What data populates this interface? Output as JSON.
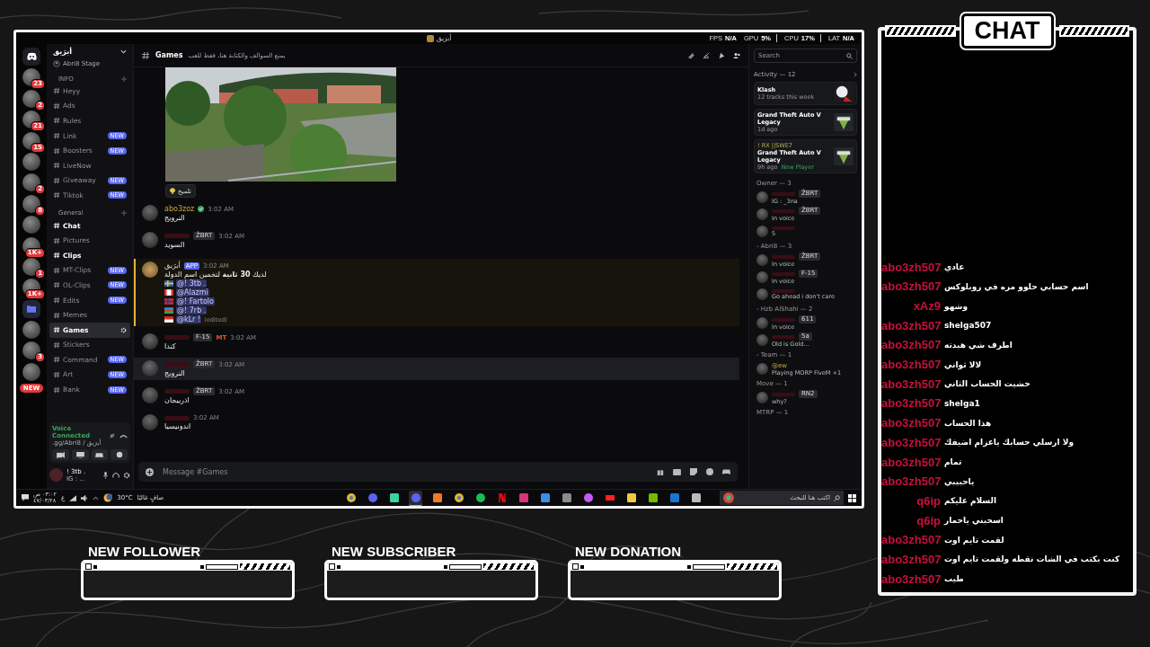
{
  "discord": {
    "title": "أبرَيق",
    "stats": [
      {
        "label": "FPS",
        "value": "N/A"
      },
      {
        "label": "GPU",
        "value": "5%"
      },
      {
        "label": "CPU",
        "value": "17%"
      },
      {
        "label": "LAT",
        "value": "N/A"
      }
    ],
    "servers": [
      {
        "kind": "home"
      },
      {
        "kind": "server",
        "badge": "23"
      },
      {
        "kind": "server",
        "badge": "2"
      },
      {
        "kind": "server",
        "badge": "21"
      },
      {
        "kind": "server",
        "badge": "15"
      },
      {
        "kind": "server"
      },
      {
        "kind": "server",
        "badge": "2"
      },
      {
        "kind": "server",
        "badge": "8"
      },
      {
        "kind": "server"
      },
      {
        "kind": "server",
        "badge": "1K+"
      },
      {
        "kind": "server",
        "badge": "1"
      },
      {
        "kind": "server",
        "badge": "1K+"
      },
      {
        "kind": "folder"
      },
      {
        "kind": "server"
      },
      {
        "kind": "server",
        "badge": "3"
      },
      {
        "kind": "server"
      },
      {
        "kind": "new",
        "label": "NEW"
      }
    ],
    "server_name": "أبرَيق",
    "stage": "Abri8 Stage",
    "categories": [
      {
        "name": "INFO",
        "channels": [
          {
            "name": "Heyy",
            "unread": false,
            "selected": false
          },
          {
            "name": "Ads",
            "unread": false,
            "selected": false
          },
          {
            "name": "Rules",
            "unread": false,
            "selected": false
          },
          {
            "name": "Link",
            "badge": "NEW",
            "unread": false,
            "selected": false
          },
          {
            "name": "Boosters",
            "badge": "NEW",
            "unread": false,
            "selected": false
          },
          {
            "name": "LiveNow",
            "unread": false,
            "selected": false
          },
          {
            "name": "Giveaway",
            "badge": "NEW",
            "unread": false,
            "selected": false
          },
          {
            "name": "Tiktok",
            "badge": "NEW",
            "unread": false,
            "selected": false
          }
        ]
      },
      {
        "name": "General",
        "channels": [
          {
            "name": "Chat",
            "unread": true,
            "selected": false
          },
          {
            "name": "Pictures",
            "unread": false,
            "selected": false
          },
          {
            "name": "Clips",
            "unread": true,
            "selected": false
          },
          {
            "name": "MT-Clips",
            "badge": "NEW",
            "unread": false,
            "selected": false
          },
          {
            "name": "OL-Clips",
            "badge": "NEW",
            "unread": false,
            "selected": false
          },
          {
            "name": "Edits",
            "badge": "NEW",
            "unread": false,
            "selected": false
          },
          {
            "name": "Memes",
            "unread": false,
            "selected": false
          },
          {
            "name": "Games",
            "unread": false,
            "selected": true
          },
          {
            "name": "Stickers",
            "unread": false,
            "selected": false
          },
          {
            "name": "Command",
            "badge": "NEW",
            "unread": false,
            "selected": false
          },
          {
            "name": "Art",
            "badge": "NEW",
            "unread": false,
            "selected": false
          },
          {
            "name": "Bank",
            "badge": "NEW",
            "unread": false,
            "selected": false
          }
        ]
      }
    ],
    "voice": {
      "status": "Voice Connected",
      "location": ".gg/Abri8 / أبرَيق"
    },
    "user": {
      "name": "! 3tb .",
      "status": "IG : ..."
    },
    "channel": {
      "name": "Games",
      "topic": "يمنع السوالف والكتابة هنا، فقط للعب"
    },
    "hint_button": "تلميح",
    "messages": [
      {
        "author": "abo3zoz",
        "verified": true,
        "time": "3:02 AM",
        "text": "النرويج"
      },
      {
        "author_redacted": true,
        "tag": "ŽBRT",
        "time": "3:02 AM",
        "text": "السويد"
      },
      {
        "author": "أبرَيق",
        "app": "APP",
        "time": "3:02 AM",
        "highlighted": true,
        "text": "لديك **30 ثانية** لتخمين اسم الدولة",
        "mentions": [
          {
            "kind": "se",
            "name": "@! 3tb ."
          },
          {
            "kind": "ca",
            "name": "@Alazmi"
          },
          {
            "kind": "no",
            "name": "@! Fartolo"
          },
          {
            "kind": "az",
            "name": "@! 7rb ."
          },
          {
            "kind": "id",
            "name": "@kLr !",
            "note": "(edited)"
          }
        ]
      },
      {
        "author_redacted": true,
        "tag": "F-15",
        "tag2": "MT",
        "time": "3:02 AM",
        "text": "كندا"
      },
      {
        "author_redacted": true,
        "tag": "ŽBRT",
        "time": "3:02 AM",
        "hovered": true,
        "text": "النرويج"
      },
      {
        "author_redacted": true,
        "tag": "ŽBRT",
        "time": "3:02 AM",
        "text": "اذربيجان"
      },
      {
        "author_redacted": true,
        "time": "3:02 AM",
        "text": "اندونيسيا"
      }
    ],
    "composer": {
      "placeholder": "Message #Games"
    },
    "search": {
      "placeholder": "Search"
    },
    "activity": {
      "title": "Activity — 12",
      "cards": [
        {
          "title": "Klash",
          "sub": "12 tracks this week",
          "kind": "skull"
        },
        {
          "title": "Grand Theft Auto V Legacy",
          "sub": "1d ago",
          "kind": "gta"
        },
        {
          "user": "! RX ||SWE7",
          "title": "Grand Theft Auto V Legacy",
          "sub": "9h ago",
          "extra": "New Player",
          "kind": "gta"
        }
      ]
    },
    "member_groups": [
      {
        "title": "Owner — 3",
        "members": [
          {
            "tag": "ŽBRT",
            "status": "IG : _3na"
          },
          {
            "tag": "ŽBRT",
            "status": "In voice"
          },
          {
            "status": "5"
          }
        ]
      },
      {
        "title": "- Abri8 — 3",
        "members": [
          {
            "tag": "ŽBRT",
            "status": "In voice"
          },
          {
            "tag": "F-15",
            "status": "In voice"
          },
          {
            "status": "Go ahead i don't care"
          }
        ]
      },
      {
        "title": "- Hzb AlShahi — 2",
        "members": [
          {
            "tag": "611",
            "status": "In voice"
          },
          {
            "tag": "5a",
            "status": "Old is Gold..."
          }
        ]
      },
      {
        "title": "- Team — 1",
        "members": [
          {
            "name": "@ew",
            "status": "Playing MORP FiveM +1"
          }
        ]
      },
      {
        "title": "Move — 1",
        "members": [
          {
            "tag": "RN2",
            "status": "why?"
          }
        ]
      },
      {
        "title": "MTRP — 1"
      }
    ],
    "taskbar": {
      "time": "٠٣:٠٢ ص",
      "date": "٤٧/٠٣/٢٨",
      "lang": "ع",
      "temperature": "30°C",
      "weather": "صافٍ غالبًا",
      "search_placeholder": "اكتب هنا للبحث",
      "apps": [
        {
          "kind": "chrome",
          "selected": false
        },
        {
          "kind": "discord",
          "selected": false
        },
        {
          "kind": "green",
          "selected": false
        },
        {
          "kind": "discord",
          "selected": true
        },
        {
          "kind": "orange",
          "selected": false
        },
        {
          "kind": "chrome",
          "selected": false
        },
        {
          "kind": "spotify",
          "selected": false
        },
        {
          "kind": "netflix",
          "selected": false
        },
        {
          "kind": "pink",
          "selected": false
        },
        {
          "kind": "store",
          "selected": false
        },
        {
          "kind": "amazon",
          "selected": false
        },
        {
          "kind": "drop",
          "selected": false
        },
        {
          "kind": "youtube",
          "selected": false
        },
        {
          "kind": "folder",
          "selected": false
        },
        {
          "kind": "nvidia",
          "selected": false
        },
        {
          "kind": "outlook",
          "selected": false
        },
        {
          "kind": "snip",
          "selected": false
        }
      ]
    }
  },
  "chat": {
    "title": "CHAT",
    "messages": [
      {
        "user": "abo3zh507",
        "text": "عادي"
      },
      {
        "user": "abo3zh507",
        "text": "اسم حسابي حلوو مره في روبلوكس"
      },
      {
        "user": "xAz9",
        "text": "وشهو"
      },
      {
        "user": "abo3zh507",
        "text": "shelga507"
      },
      {
        "user": "abo3zh507",
        "text": "اطرف شي هبدته"
      },
      {
        "user": "abo3zh507",
        "text": "لالا ثواني"
      },
      {
        "user": "abo3zh507",
        "text": "خشيت الحساب الثاني"
      },
      {
        "user": "abo3zh507",
        "text": "shelga1"
      },
      {
        "user": "abo3zh507",
        "text": "هذا الحساب"
      },
      {
        "user": "abo3zh507",
        "text": "ولا ارسلي حسابك ياعزام اضيفك"
      },
      {
        "user": "abo3zh507",
        "text": "تمام"
      },
      {
        "user": "abo3zh507",
        "text": "ياحبيبي"
      },
      {
        "user": "q6ip",
        "text": "السلام عليكم"
      },
      {
        "user": "q6ip",
        "text": "اسحبني ياحمار"
      },
      {
        "user": "abo3zh507",
        "text": "لقمت تايم اوت"
      },
      {
        "user": "abo3zh507",
        "text": "كنت بكتب في الشات نقطه ولقمت تايم اوت"
      },
      {
        "user": "abo3zh507",
        "text": "طيب"
      }
    ]
  },
  "alerts": [
    {
      "title": "NEW FOLLOWER"
    },
    {
      "title": "NEW SUBSCRIBER"
    },
    {
      "title": "NEW DONATION"
    }
  ]
}
